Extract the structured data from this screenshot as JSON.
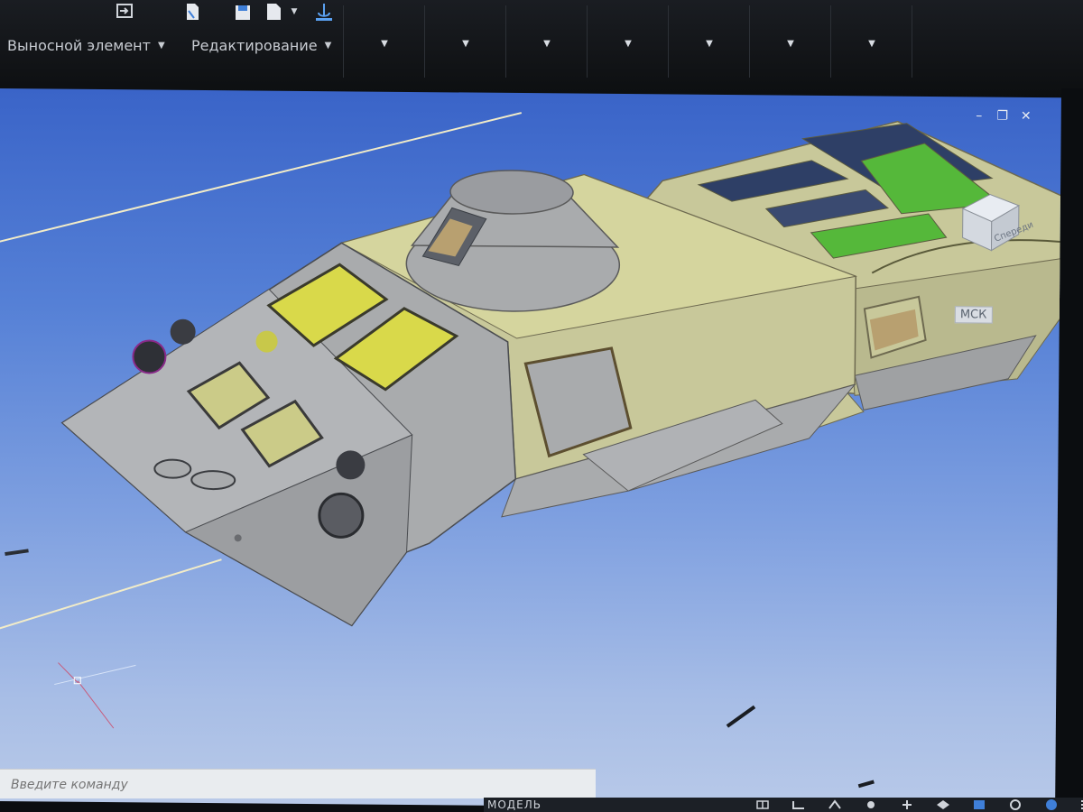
{
  "ribbon": {
    "panels": [
      {
        "label": "Выносной элемент"
      },
      {
        "label": "Редактирование"
      }
    ],
    "top_icons": [
      "array-icon",
      "document-icon",
      "save-icon",
      "page-icon",
      "anchor-icon"
    ],
    "caret_dropdowns": 7
  },
  "viewport": {
    "background_top": "#3a64c8",
    "background_bottom": "#b8c9e8",
    "model": {
      "hull_color": "#c8c89a",
      "body_color": "#a9abad",
      "glass_color": "#d9d94a",
      "green_area_color": "#55b83a",
      "axis_line_color": "#f2ecc8"
    },
    "viewcube_label": "Спереди",
    "wcs_label": "МСК",
    "window_controls": [
      "minimize-icon",
      "restore-icon",
      "close-icon"
    ]
  },
  "command_line": {
    "placeholder": "Введите команду"
  },
  "status_bar": {
    "model_tab": "МОДЕЛЬ"
  }
}
